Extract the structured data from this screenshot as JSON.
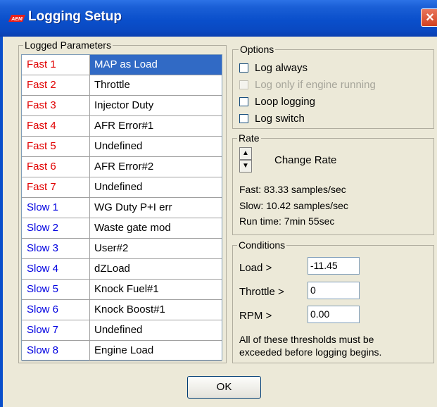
{
  "window": {
    "title": "Logging Setup",
    "logo_text": "AEM",
    "close_glyph": "×"
  },
  "logged_parameters": {
    "label": "Logged Parameters",
    "rows": [
      {
        "slot": "Fast 1",
        "param": "MAP as Load",
        "speed": "fast",
        "selected": true
      },
      {
        "slot": "Fast 2",
        "param": "Throttle",
        "speed": "fast"
      },
      {
        "slot": "Fast 3",
        "param": "Injector Duty",
        "speed": "fast"
      },
      {
        "slot": "Fast 4",
        "param": "AFR Error#1",
        "speed": "fast"
      },
      {
        "slot": "Fast 5",
        "param": "Undefined",
        "speed": "fast"
      },
      {
        "slot": "Fast 6",
        "param": "AFR Error#2",
        "speed": "fast"
      },
      {
        "slot": "Fast 7",
        "param": "Undefined",
        "speed": "fast"
      },
      {
        "slot": "Slow 1",
        "param": "WG Duty P+I err",
        "speed": "slow"
      },
      {
        "slot": "Slow 2",
        "param": "Waste gate mod",
        "speed": "slow"
      },
      {
        "slot": "Slow 3",
        "param": "User#2",
        "speed": "slow"
      },
      {
        "slot": "Slow 4",
        "param": "dZLoad",
        "speed": "slow"
      },
      {
        "slot": "Slow 5",
        "param": "Knock Fuel#1",
        "speed": "slow"
      },
      {
        "slot": "Slow 6",
        "param": "Knock Boost#1",
        "speed": "slow"
      },
      {
        "slot": "Slow 7",
        "param": "Undefined",
        "speed": "slow"
      },
      {
        "slot": "Slow 8",
        "param": "Engine Load",
        "speed": "slow"
      }
    ]
  },
  "options": {
    "label": "Options",
    "log_always": "Log always",
    "log_only_running": "Log only if engine running",
    "loop_logging": "Loop logging",
    "log_switch": "Log switch"
  },
  "rate": {
    "label": "Rate",
    "spin_up": "▲",
    "spin_down": "▼",
    "change_label": "Change Rate",
    "fast": "Fast: 83.33 samples/sec",
    "slow": "Slow: 10.42 samples/sec",
    "run_time": "Run time: 7min 55sec"
  },
  "conditions": {
    "label": "Conditions",
    "load_label": "Load >",
    "load_value": "-11.45",
    "throttle_label": "Throttle >",
    "throttle_value": "0",
    "rpm_label": "RPM >",
    "rpm_value": "0.00",
    "note_line1": "All of these thresholds must be",
    "note_line2": "exceeded before logging begins."
  },
  "ok_label": "OK",
  "colors": {
    "fast": "#e00000",
    "slow": "#0000e0",
    "selection": "#316ac5",
    "titlebar": "#0a4fcb"
  }
}
